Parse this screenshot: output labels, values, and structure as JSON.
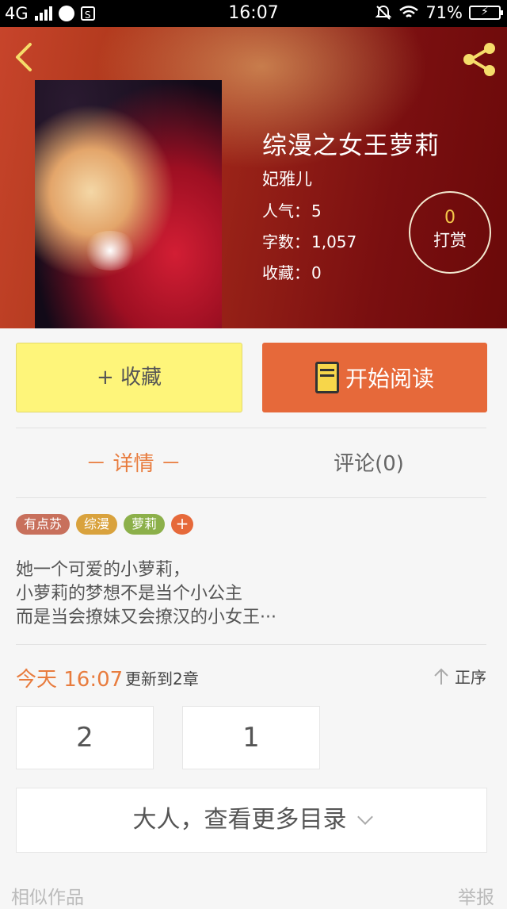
{
  "status_bar": {
    "network": "4G",
    "time": "16:07",
    "battery_pct": "71%"
  },
  "book": {
    "title": "综漫之女王萝莉",
    "author": "妃雅儿",
    "popularity_label": "人气：",
    "popularity": "5",
    "words_label": "字数：",
    "words": "1,057",
    "favorites_label": "收藏：",
    "favorites": "0"
  },
  "reward": {
    "count": "0",
    "label": "打赏"
  },
  "actions": {
    "favorite": "+ 收藏",
    "read": "开始阅读"
  },
  "tabs": {
    "detail": "－ 详情 －",
    "comments": "评论(0)"
  },
  "tags": [
    {
      "label": "有点苏",
      "color": "#c8705c"
    },
    {
      "label": "综漫",
      "color": "#d9a23d"
    },
    {
      "label": "萝莉",
      "color": "#8cb04a"
    }
  ],
  "tag_add": "+",
  "description": {
    "line1": "她一个可爱的小萝莉，",
    "line2": "小萝莉的梦想不是当个小公主",
    "line3": "而是当会撩妹又会撩汉的小女王···"
  },
  "update": {
    "time": "今天 16:07",
    "text": "更新到2章",
    "sort": "正序"
  },
  "chapters": [
    "2",
    "1"
  ],
  "more_catalog": "大人，查看更多目录",
  "footer": {
    "similar": "相似作品",
    "report": "举报"
  },
  "colors": {
    "accent": "#e6693a",
    "favorite_bg": "#fef57a"
  }
}
